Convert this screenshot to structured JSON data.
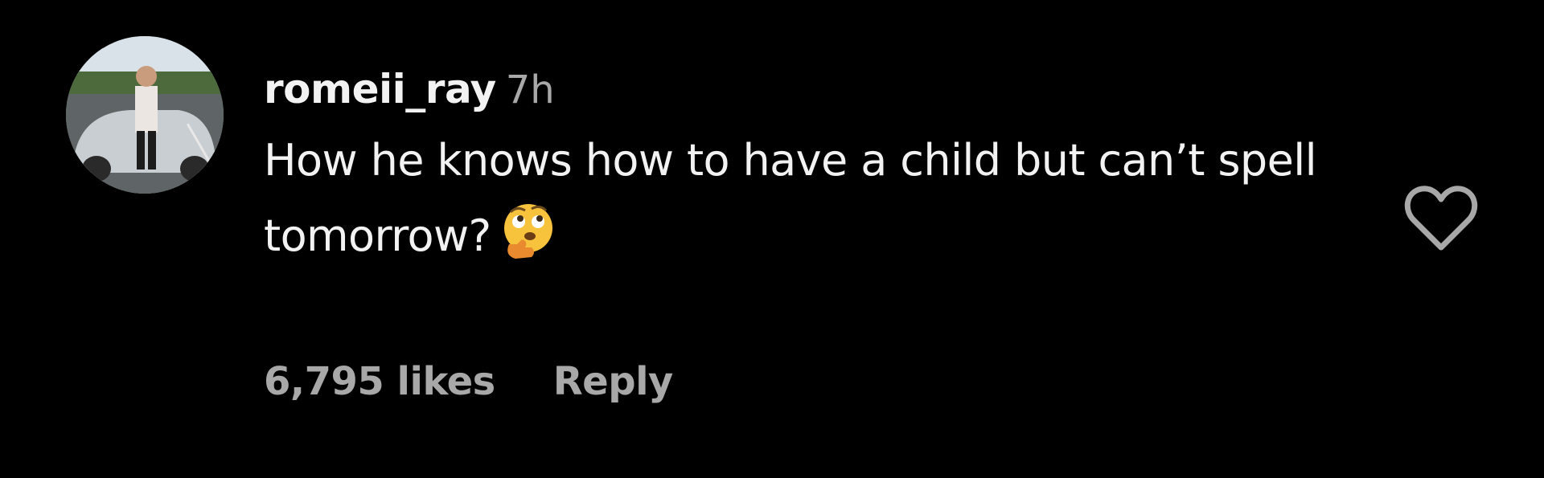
{
  "comment": {
    "username": "romeii_ray",
    "timestamp": "7h",
    "text": "How he knows how to have a child but can’t spell tomorrow?",
    "emoji": "thinking-face-with-raised-eyebrow-emoji",
    "likes": "6,795 likes",
    "reply_label": "Reply",
    "like_icon": "heart-outline-icon"
  },
  "colors": {
    "background": "#000000",
    "primary_text": "#f2f2f2",
    "secondary_text": "#a8a8a8",
    "heart_outline": "#a8a8a8"
  }
}
